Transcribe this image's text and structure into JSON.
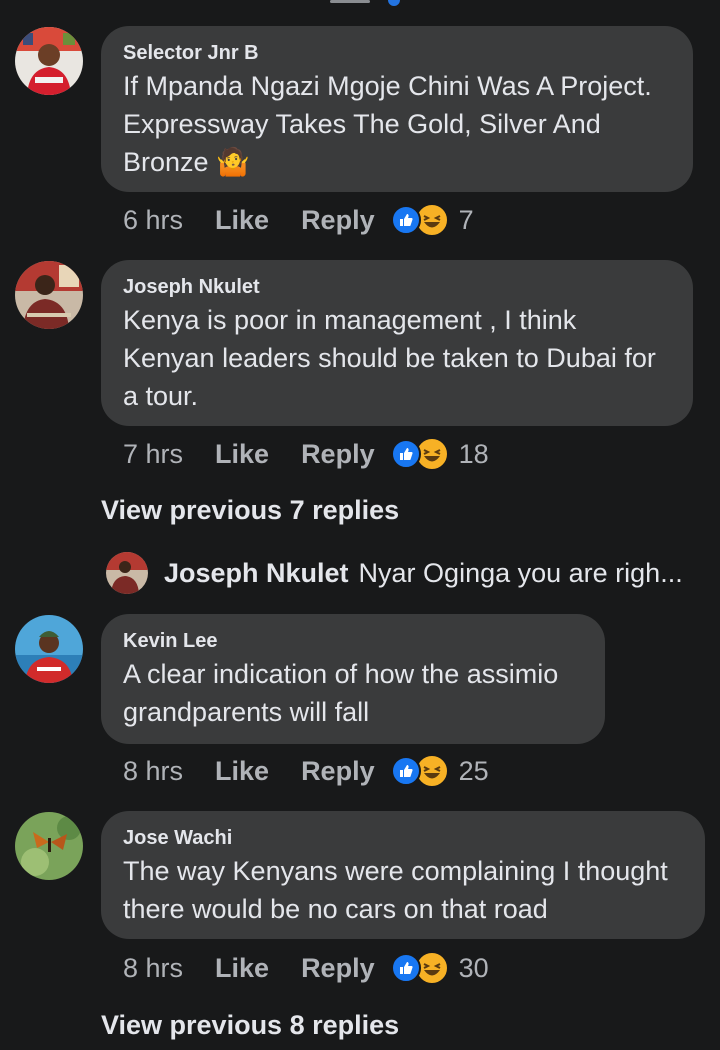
{
  "comments": [
    {
      "author": "Selector Jnr B",
      "text_lines": [
        "If Mpanda Ngazi Mgoje Chini Was A Project.",
        "Expressway Takes The Gold, Silver And",
        "Bronze 🤷"
      ],
      "time": "6 hrs",
      "like_label": "Like",
      "reply_label": "Reply",
      "reaction_count": "7"
    },
    {
      "author": "Joseph Nkulet",
      "text_lines": [
        "Kenya is poor in management , I think",
        "Kenyan leaders should be taken to Dubai for",
        "a tour."
      ],
      "time": "7 hrs",
      "like_label": "Like",
      "reply_label": "Reply",
      "reaction_count": "18"
    },
    {
      "author": "Kevin Lee",
      "text_lines": [
        "A clear indication of how the assimio",
        "grandparents will fall"
      ],
      "time": "8 hrs",
      "like_label": "Like",
      "reply_label": "Reply",
      "reaction_count": "25"
    },
    {
      "author": "Jose Wachi",
      "text_lines": [
        "The way Kenyans were complaining I thought",
        "there would be no cars on that road"
      ],
      "time": "8 hrs",
      "like_label": "Like",
      "reply_label": "Reply",
      "reaction_count": "30"
    }
  ],
  "view_previous_1": "View previous 7 replies",
  "reply_preview": {
    "author": "Joseph Nkulet",
    "text": "Nyar Oginga you are righ..."
  },
  "view_previous_2": "View previous 8 replies",
  "colors": {
    "background": "#18191a",
    "bubble": "#3a3b3c",
    "primary_text": "#e4e6eb",
    "secondary_text": "#b0b3b8",
    "like_blue": "#1877f2",
    "haha_yellow": "#f7b125"
  },
  "icons": {
    "reaction_like": "thumbs-up-icon",
    "reaction_haha": "laughing-face-icon"
  }
}
